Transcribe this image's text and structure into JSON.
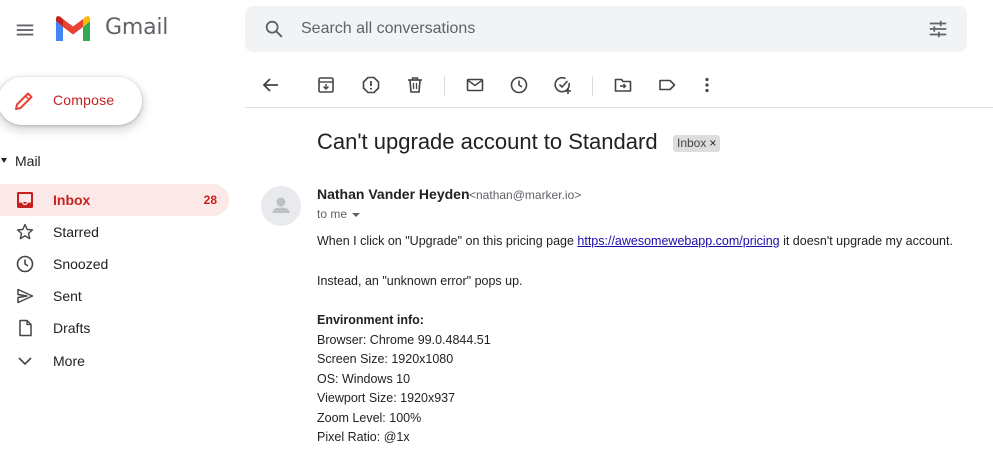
{
  "header": {
    "brand": "Gmail",
    "search_placeholder": "Search all conversations"
  },
  "sidebar": {
    "compose_label": "Compose",
    "section_label": "Mail",
    "items": [
      {
        "label": "Inbox",
        "count": "28",
        "icon": "inbox-icon",
        "active": true
      },
      {
        "label": "Starred",
        "icon": "star-icon"
      },
      {
        "label": "Snoozed",
        "icon": "clock-icon"
      },
      {
        "label": "Sent",
        "icon": "send-icon"
      },
      {
        "label": "Drafts",
        "icon": "draft-icon"
      },
      {
        "label": "More",
        "icon": "chevron-down-icon"
      }
    ]
  },
  "toolbar": {
    "icons": [
      "back-arrow-icon",
      "archive-icon",
      "report-spam-icon",
      "delete-icon",
      "mark-unread-icon",
      "snooze-icon",
      "add-task-icon",
      "move-to-icon",
      "label-icon",
      "more-vert-icon"
    ]
  },
  "message": {
    "subject": "Can't upgrade account to Standard",
    "label_chip": "Inbox",
    "label_chip_close": "×",
    "sender_name": "Nathan Vander Heyden",
    "sender_email": "<nathan@marker.io>",
    "to_line": "to me",
    "body": {
      "line1_prefix": "When I click on \"Upgrade\" on this pricing page ",
      "line1_link": "https://awesomewebapp.com/pricing",
      "line1_suffix": " it doesn't upgrade my account.",
      "line2": "Instead, an \"unknown error\" pops up.",
      "env_heading": "Environment info:",
      "env": [
        "Browser: Chrome 99.0.4844.51",
        "Screen Size: 1920x1080",
        "OS: Windows 10",
        "Viewport Size: 1920x937",
        "Zoom Level: 100%",
        "Pixel Ratio: @1x"
      ]
    }
  },
  "colors": {
    "accent_red": "#c5221f",
    "active_bg": "#fce8e6",
    "search_bg": "#f1f3f4",
    "link": "#1a0dab"
  }
}
